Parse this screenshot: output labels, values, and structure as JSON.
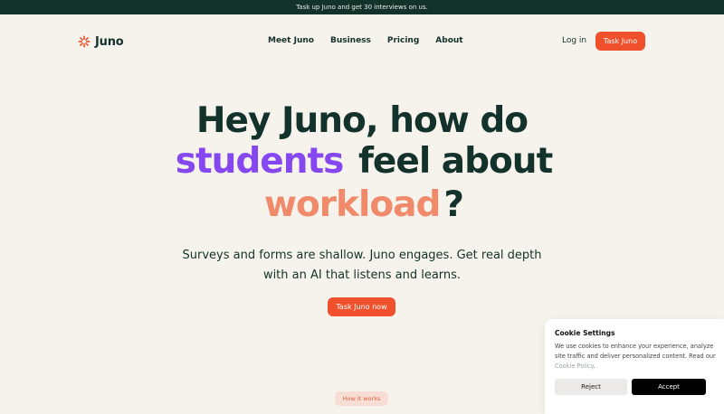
{
  "announcement": {
    "text": "Task up Juno and get 30 interviews on us."
  },
  "brand": {
    "name": "Juno",
    "accent": "#f0512c"
  },
  "nav": {
    "items": [
      {
        "label": "Meet Juno"
      },
      {
        "label": "Business"
      },
      {
        "label": "Pricing"
      },
      {
        "label": "About"
      }
    ],
    "login_label": "Log in",
    "cta_label": "Task Juno"
  },
  "hero": {
    "line1": "Hey Juno, how do",
    "highlight1": "students",
    "line2_rest": "feel about",
    "highlight2": "workload",
    "line3_rest": "?",
    "subtitle": "Surveys and forms are shallow. Juno engages. Get real depth with an AI that listens and learns.",
    "cta_label": "Task Juno now",
    "how_label": "How it works"
  },
  "cookie": {
    "title": "Cookie Settings",
    "body": "We use cookies to enhance your experience, analyze site traffic and deliver personalized content. Read our",
    "link_label": "Cookie Policy",
    "body_end": ".",
    "reject_label": "Reject",
    "accept_label": "Accept"
  }
}
